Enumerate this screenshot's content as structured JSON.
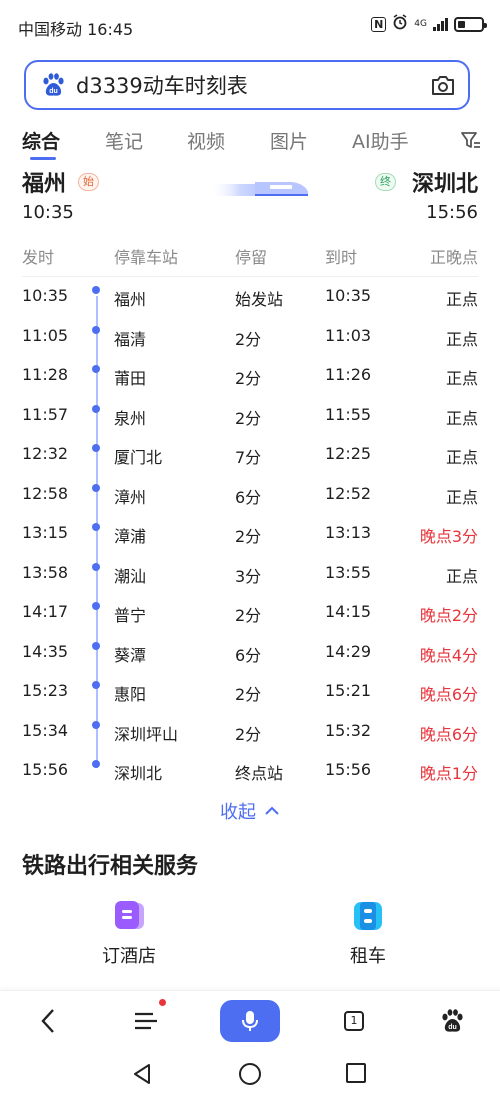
{
  "status_bar": {
    "carrier_time": "中国移动 16:45",
    "nfc": "N",
    "alarm_icon": "alarm-icon",
    "network": "4G",
    "battery_level": 0.3
  },
  "search": {
    "query": "d3339动车时刻表",
    "logo_icon": "baidu-paw-icon",
    "camera_icon": "camera-icon"
  },
  "tabs": [
    {
      "label": "综合",
      "active": true
    },
    {
      "label": "笔记",
      "active": false
    },
    {
      "label": "视频",
      "active": false
    },
    {
      "label": "图片",
      "active": false
    },
    {
      "label": "AI助手",
      "active": false
    }
  ],
  "train": {
    "from_station": "福州",
    "from_badge": "始",
    "from_time": "10:35",
    "to_station": "深圳北",
    "to_badge": "终",
    "to_time": "15:56"
  },
  "table": {
    "headers": {
      "departure": "发时",
      "station": "停靠车站",
      "stop": "停留",
      "arrival": "到时",
      "punctuality": "正晚点"
    },
    "rows": [
      {
        "dep": "10:35",
        "station": "福州",
        "stop": "始发站",
        "arr": "10:35",
        "status": "正点",
        "late": false
      },
      {
        "dep": "11:05",
        "station": "福清",
        "stop": "2分",
        "arr": "11:03",
        "status": "正点",
        "late": false
      },
      {
        "dep": "11:28",
        "station": "莆田",
        "stop": "2分",
        "arr": "11:26",
        "status": "正点",
        "late": false
      },
      {
        "dep": "11:57",
        "station": "泉州",
        "stop": "2分",
        "arr": "11:55",
        "status": "正点",
        "late": false
      },
      {
        "dep": "12:32",
        "station": "厦门北",
        "stop": "7分",
        "arr": "12:25",
        "status": "正点",
        "late": false
      },
      {
        "dep": "12:58",
        "station": "漳州",
        "stop": "6分",
        "arr": "12:52",
        "status": "正点",
        "late": false
      },
      {
        "dep": "13:15",
        "station": "漳浦",
        "stop": "2分",
        "arr": "13:13",
        "status": "晚点3分",
        "late": true
      },
      {
        "dep": "13:58",
        "station": "潮汕",
        "stop": "3分",
        "arr": "13:55",
        "status": "正点",
        "late": false
      },
      {
        "dep": "14:17",
        "station": "普宁",
        "stop": "2分",
        "arr": "14:15",
        "status": "晚点2分",
        "late": true
      },
      {
        "dep": "14:35",
        "station": "葵潭",
        "stop": "6分",
        "arr": "14:29",
        "status": "晚点4分",
        "late": true
      },
      {
        "dep": "15:23",
        "station": "惠阳",
        "stop": "2分",
        "arr": "15:21",
        "status": "晚点6分",
        "late": true
      },
      {
        "dep": "15:34",
        "station": "深圳坪山",
        "stop": "2分",
        "arr": "15:32",
        "status": "晚点6分",
        "late": true
      },
      {
        "dep": "15:56",
        "station": "深圳北",
        "stop": "终点站",
        "arr": "15:56",
        "status": "晚点1分",
        "late": true
      }
    ]
  },
  "collapse_label": "收起",
  "services": {
    "title": "铁路出行相关服务",
    "items": [
      {
        "label": "订酒店",
        "icon": "hotel-icon"
      },
      {
        "label": "租车",
        "icon": "car-rental-icon"
      }
    ]
  },
  "bottom_nav": {
    "tab_count": "1",
    "icons": [
      "back-icon",
      "menu-icon",
      "microphone-icon",
      "tabs-icon",
      "baidu-icon"
    ]
  },
  "system_nav": [
    "back-triangle-icon",
    "home-circle-icon",
    "recents-square-icon"
  ],
  "colors": {
    "accent": "#4e6ef2",
    "late": "#e8343a",
    "start_badge": "#e5653d",
    "end_badge": "#2ea360"
  }
}
